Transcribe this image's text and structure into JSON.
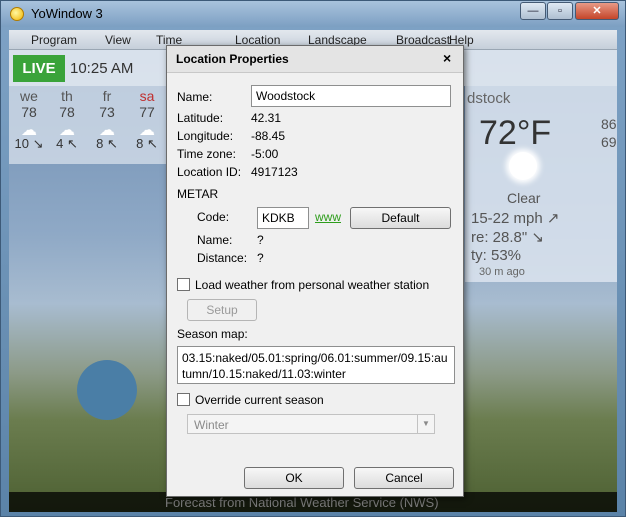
{
  "window": {
    "title": "YoWindow 3"
  },
  "menu": [
    "Program",
    "View",
    "Time",
    "Location",
    "Landscape",
    "Broadcast",
    "Help"
  ],
  "background": {
    "live_label": "LIVE",
    "time": "10:25 AM",
    "forecast": [
      {
        "day": "we",
        "high": "78",
        "wind": "10 ↘"
      },
      {
        "day": "th",
        "high": "78",
        "wind": "4 ↖"
      },
      {
        "day": "fr",
        "high": "73",
        "wind": "8 ↖"
      },
      {
        "day": "sa",
        "high": "77",
        "wind": "8 ↖"
      }
    ],
    "location": "dstock",
    "temperature": "72°F",
    "high": "86",
    "low": "69",
    "condition": "Clear",
    "wind": "15-22 mph ↗",
    "pressure": "re:  28.8\" ↘",
    "humidity": "ty:  53%",
    "age": "30 m ago",
    "footer": "Forecast from National Weather Service (NWS)"
  },
  "dialog": {
    "title": "Location Properties",
    "close_glyph": "×",
    "name_label": "Name:",
    "name_value": "Woodstock",
    "latitude_label": "Latitude:",
    "latitude_value": "42.31",
    "longitude_label": "Longitude:",
    "longitude_value": "-88.45",
    "timezone_label": "Time zone:",
    "timezone_value": "-5:00",
    "location_id_label": "Location ID:",
    "location_id_value": "4917123",
    "metar_heading": "METAR",
    "code_label": "Code:",
    "code_value": "KDKB",
    "www_link": "www",
    "default_button": "Default",
    "metar_name_label": "Name:",
    "metar_name_value": "?",
    "distance_label": "Distance:",
    "distance_value": "?",
    "load_pws_label": "Load weather from personal weather station",
    "load_pws_checked": false,
    "setup_button": "Setup",
    "season_map_label": "Season map:",
    "season_map_value": "03.15:naked/05.01:spring/06.01:summer/09.15:autumn/10.15:naked/11.03:winter",
    "override_label": "Override current season",
    "override_checked": false,
    "season_select_value": "Winter",
    "ok_button": "OK",
    "cancel_button": "Cancel"
  }
}
